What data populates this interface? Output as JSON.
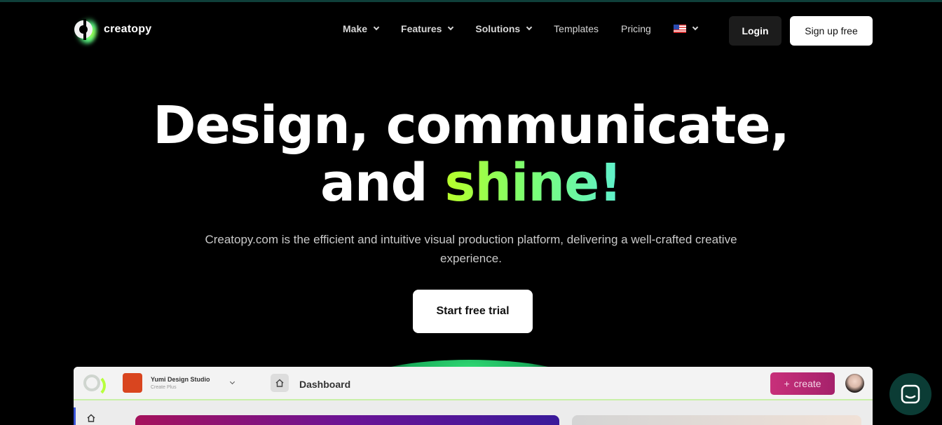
{
  "brand": {
    "name": "creatopy",
    "accent": "#b9ff2a",
    "accent2": "#5ef0d0"
  },
  "nav": {
    "items": [
      {
        "label": "Make",
        "dropdown": true
      },
      {
        "label": "Features",
        "dropdown": true
      },
      {
        "label": "Solutions",
        "dropdown": true
      },
      {
        "label": "Templates",
        "dropdown": false
      },
      {
        "label": "Pricing",
        "dropdown": false
      }
    ],
    "language_icon": "us-flag-icon",
    "login": "Login",
    "signup": "Sign up free"
  },
  "hero": {
    "line1": "Design, communicate,",
    "line2_prefix": "and ",
    "line2_highlight": "shine!",
    "subtitle": "Creatopy.com is the efficient and intuitive visual production platform, delivering a well-crafted creative experience.",
    "cta": "Start free trial"
  },
  "preview": {
    "studio_name": "Yumi Design Studio",
    "studio_plan": "Create Plus",
    "page_title": "Dashboard",
    "create_button": "create"
  },
  "chat": {
    "icon": "chat-icon"
  }
}
